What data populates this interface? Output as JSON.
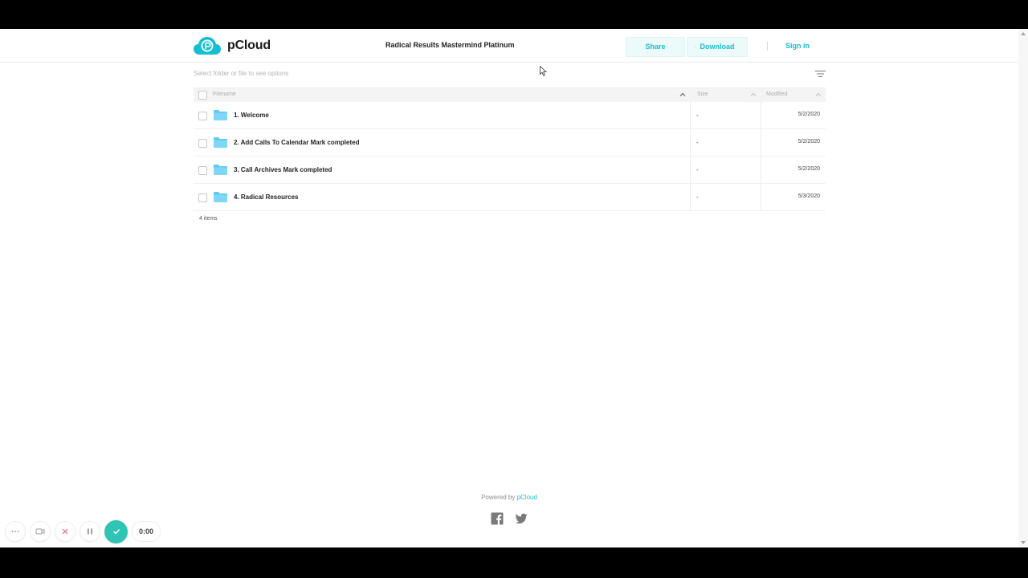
{
  "header": {
    "brand": "pCloud",
    "share_title": "Radical Results Mastermind Platinum",
    "share_label": "Share",
    "download_label": "Download",
    "signin_label": "Sign in"
  },
  "toolbar": {
    "hint": "Select folder or file to see options"
  },
  "table": {
    "columns": {
      "filename": "Filename",
      "size": "Size",
      "modified": "Modified"
    },
    "rows": [
      {
        "name": "1. Welcome",
        "size": "-",
        "modified": "5/2/2020",
        "icon": "folder-icon"
      },
      {
        "name": "2. Add Calls To Calendar Mark completed",
        "size": "-",
        "modified": "5/2/2020",
        "icon": "folder-icon"
      },
      {
        "name": "3. Call Archives Mark completed",
        "size": "-",
        "modified": "5/2/2020",
        "icon": "folder-icon"
      },
      {
        "name": "4. Radical Resources",
        "size": "-",
        "modified": "5/3/2020",
        "icon": "folder-icon"
      }
    ],
    "count": "4 items"
  },
  "footer": {
    "powered_prefix": "Powered by",
    "powered_link": "pCloud",
    "social": [
      "facebook-icon",
      "twitter-icon"
    ]
  },
  "recorder": {
    "time": "0:00"
  },
  "colors": {
    "accent": "#17bed0",
    "folder": "#5ec8f2",
    "record_check": "#2fc4b4"
  }
}
